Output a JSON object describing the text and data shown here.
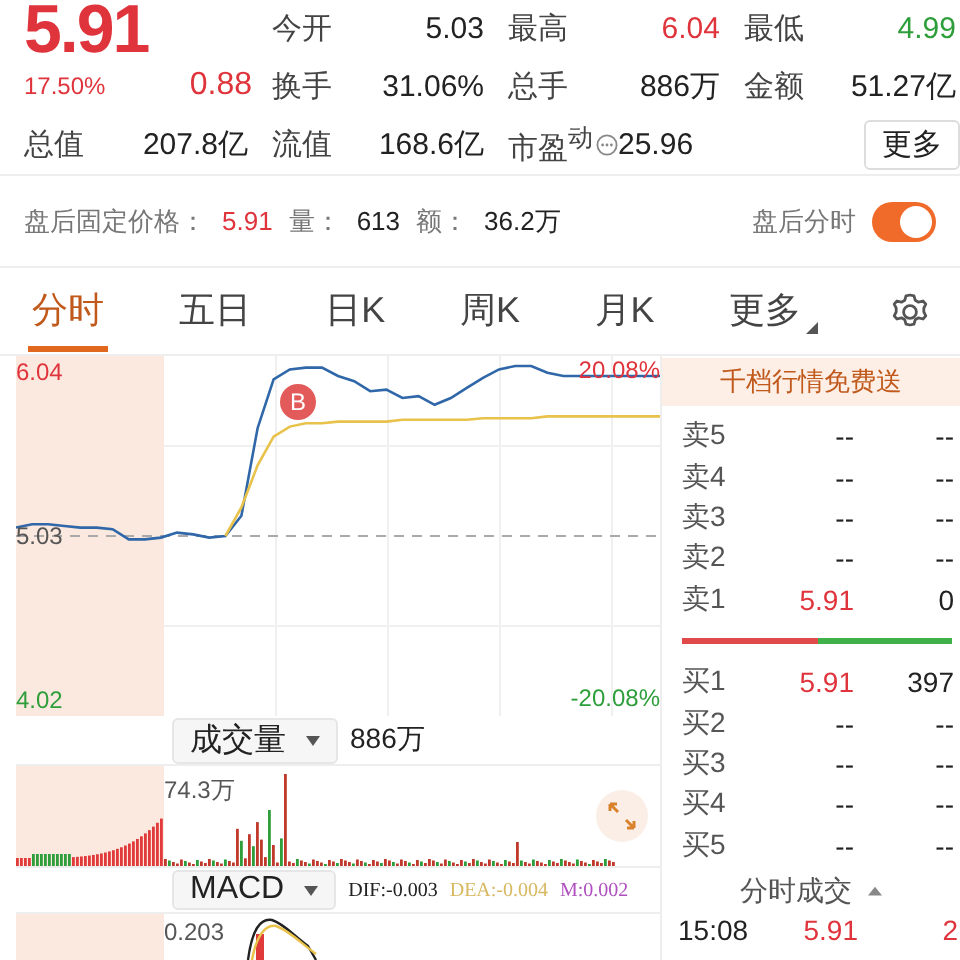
{
  "quote": {
    "price": "5.91",
    "change_pct": "17.50%",
    "change": "0.88",
    "color": "#e0343c",
    "stats": [
      {
        "label": "今开",
        "value": "5.03",
        "color": "#222222"
      },
      {
        "label": "最高",
        "value": "6.04",
        "color": "#e0343c"
      },
      {
        "label": "最低",
        "value": "4.99",
        "color": "#2e9e3a"
      },
      {
        "label": "换手",
        "value": "31.06%",
        "color": "#222222"
      },
      {
        "label": "总手",
        "value": "886万",
        "color": "#222222"
      },
      {
        "label": "金额",
        "value": "51.27亿",
        "color": "#222222"
      },
      {
        "label": "总值",
        "value": "207.8亿",
        "color": "#222222"
      },
      {
        "label": "流值",
        "value": "168.6亿",
        "color": "#222222"
      },
      {
        "label": "市盈$^{动}$",
        "value": "25.96",
        "color": "#222222",
        "info_icon": true
      }
    ],
    "more_button": "更多"
  },
  "after_hours": {
    "label": "盘后固定价格：",
    "price": "5.91",
    "volume_label": "量：",
    "volume": "613",
    "amount_label": "额：",
    "amount": "36.2万",
    "toggle_label": "盘后分时",
    "toggle_on": true
  },
  "tabs": [
    {
      "label": "分时",
      "selected": true,
      "kind": "plain"
    },
    {
      "label": "五日",
      "selected": false,
      "kind": "plain"
    },
    {
      "label": "日K",
      "selected": false,
      "kind": "plain"
    },
    {
      "label": "周K",
      "selected": false,
      "kind": "plain"
    },
    {
      "label": "月K",
      "selected": false,
      "kind": "plain"
    },
    {
      "label": "更多",
      "selected": false,
      "kind": "dropdown"
    }
  ],
  "price_chart": {
    "high_pct": "20.08%",
    "low_pct": "-20.08%",
    "marker": "B",
    "chart_data": {
      "type": "line",
      "grid": true,
      "ref_lines": [
        {
          "axis": "y",
          "value": 5.03
        }
      ],
      "ylim": [
        4.02,
        6.04
      ],
      "yticks": [
        {
          "value": 6.04,
          "label": "6.04"
        },
        {
          "value": 5.03,
          "label": "5.03"
        },
        {
          "value": 4.02,
          "label": "4.02"
        }
      ],
      "series": [
        {
          "color": "#2f67a8",
          "values": [
            5.08,
            5.1,
            5.1,
            5.09,
            5.08,
            5.08,
            5.07,
            5.01,
            5.01,
            5.02,
            5.05,
            5.04,
            5.02,
            5.03,
            5.15,
            5.67,
            5.96,
            6.02,
            6.03,
            6.03,
            5.98,
            5.95,
            5.89,
            5.9,
            5.85,
            5.86,
            5.81,
            5.85,
            5.91,
            5.97,
            6.02,
            6.04,
            6.04,
            6.0,
            5.98,
            5.98,
            5.98,
            5.98,
            5.98,
            5.98,
            5.98
          ]
        },
        {
          "color": "#e8c24a",
          "values": [
            null,
            null,
            null,
            null,
            null,
            null,
            null,
            null,
            null,
            null,
            null,
            null,
            null,
            5.03,
            5.2,
            5.45,
            5.62,
            5.68,
            5.7,
            5.7,
            5.71,
            5.71,
            5.71,
            5.71,
            5.72,
            5.72,
            5.72,
            5.72,
            5.72,
            5.73,
            5.73,
            5.73,
            5.73,
            5.74,
            5.74,
            5.74,
            5.74,
            5.74,
            5.74,
            5.74,
            5.74
          ]
        }
      ]
    }
  },
  "volume_panel": {
    "indicator": "成交量",
    "total": "886万",
    "axis_max": "74.3万"
  },
  "macd_panel": {
    "indicator": "MACD",
    "dif": "DIF:-0.003",
    "dea": "DEA:-0.004",
    "m": "M:0.002",
    "axis_max": "0.203"
  },
  "order_book": {
    "banner": "千档行情免费送",
    "asks": [
      {
        "label": "卖5",
        "price": "--",
        "volume": "--",
        "color": "#222222"
      },
      {
        "label": "卖4",
        "price": "--",
        "volume": "--",
        "color": "#222222"
      },
      {
        "label": "卖3",
        "price": "--",
        "volume": "--",
        "color": "#222222"
      },
      {
        "label": "卖2",
        "price": "--",
        "volume": "--",
        "color": "#222222"
      },
      {
        "label": "卖1",
        "price": "5.91",
        "volume": "0",
        "color": "#e0343c"
      }
    ],
    "ratio": {
      "level": 0.5
    },
    "bids": [
      {
        "label": "买1",
        "price": "5.91",
        "volume": "397",
        "color": "#e0343c"
      },
      {
        "label": "买2",
        "price": "--",
        "volume": "--",
        "color": "#222222"
      },
      {
        "label": "买3",
        "price": "--",
        "volume": "--",
        "color": "#222222"
      },
      {
        "label": "买4",
        "price": "--",
        "volume": "--",
        "color": "#222222"
      },
      {
        "label": "买5",
        "price": "--",
        "volume": "--",
        "color": "#222222"
      }
    ],
    "trades_header": "分时成交",
    "trades": [
      {
        "time": "15:08",
        "price": "5.91",
        "volume": "2",
        "color": "#e0343c"
      }
    ]
  }
}
